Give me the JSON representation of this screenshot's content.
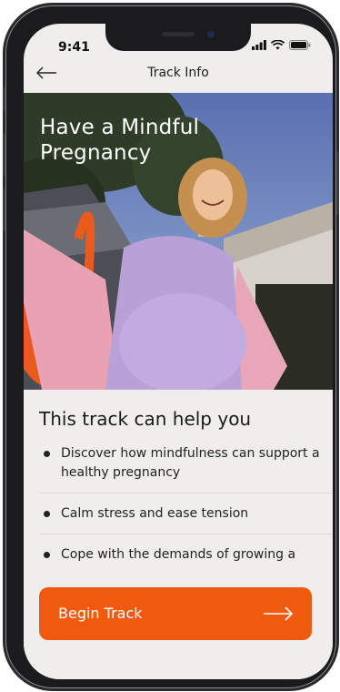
{
  "status_bar": {
    "time": "9:41"
  },
  "header": {
    "title": "Track Info"
  },
  "hero": {
    "title_line1": "Have a Mindful",
    "title_line2": "Pregnancy"
  },
  "section": {
    "title": "This track can help you",
    "items": [
      {
        "text": "Discover how mindfulness can support a healthy pregnancy"
      },
      {
        "text": "Calm stress and ease tension"
      },
      {
        "text": "Cope with the demands of growing a"
      }
    ]
  },
  "cta": {
    "label": "Begin Track"
  },
  "icons": {
    "back": "arrow-left-icon",
    "cta": "arrow-right-icon",
    "signal": "cellular-signal-icon",
    "wifi": "wifi-icon",
    "battery": "battery-icon"
  },
  "colors": {
    "accent": "#f05a0e",
    "background": "#efeeec"
  }
}
